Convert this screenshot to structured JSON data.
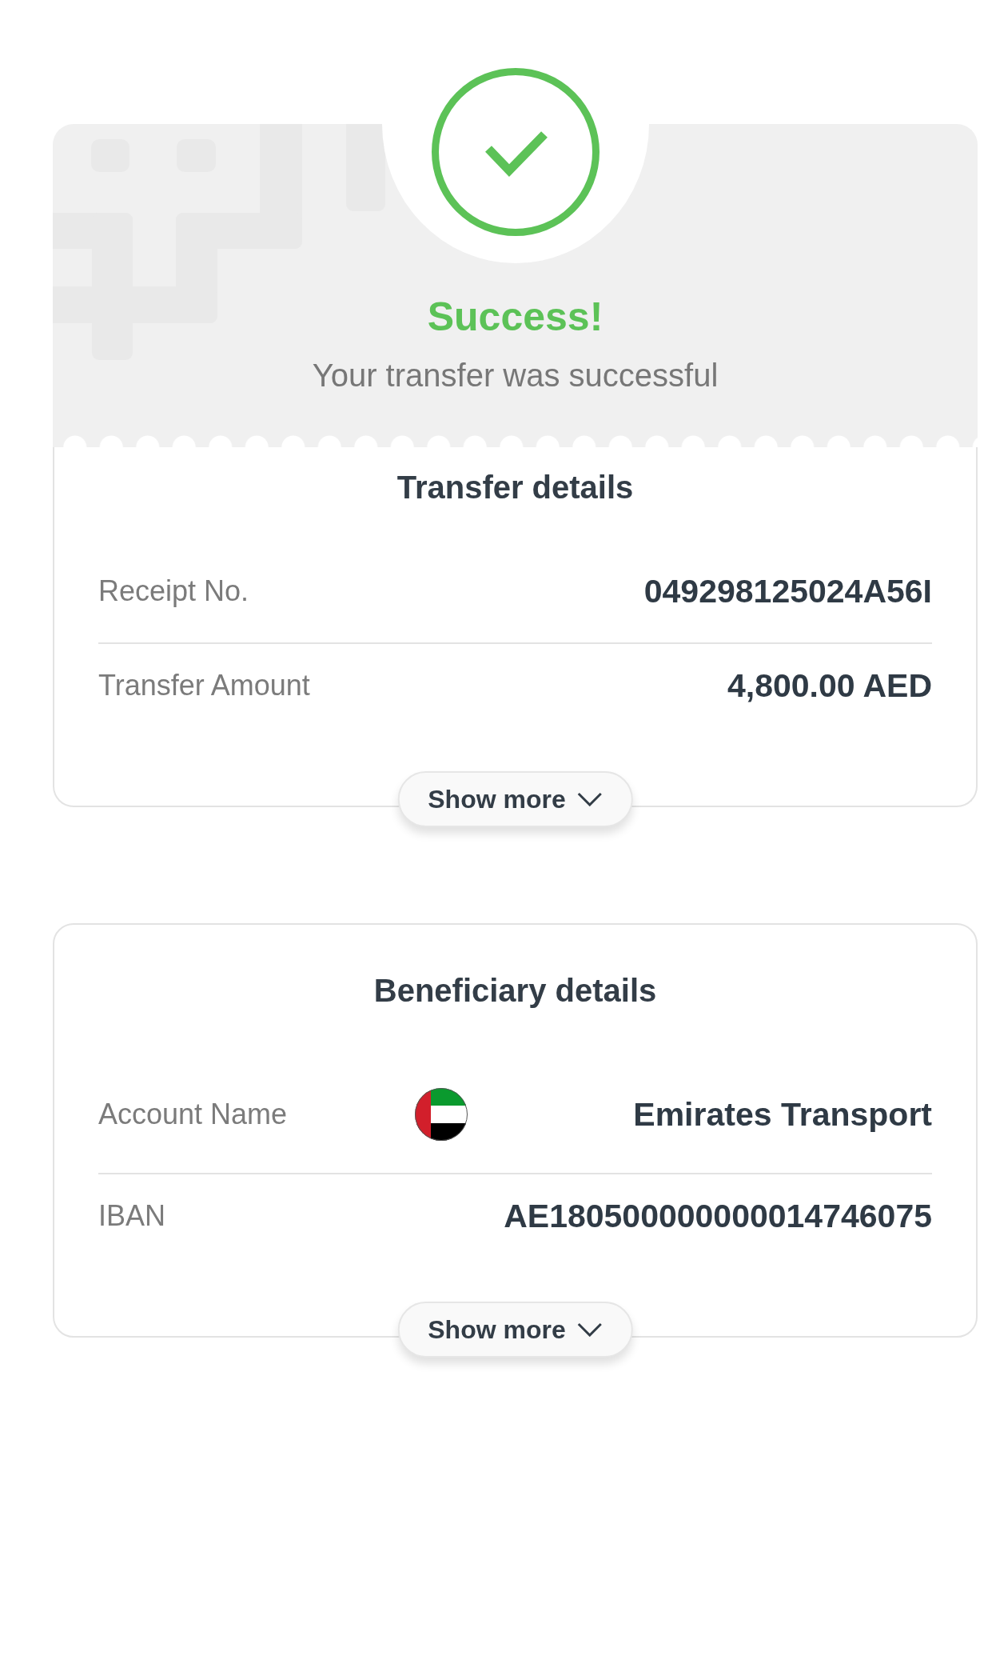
{
  "cards": [
    {
      "status": {
        "kind": "success",
        "title": "Success!",
        "message": "Your transfer was successful"
      },
      "title": "Transfer details",
      "rows": [
        {
          "kind": "plain",
          "label": "Receipt No.",
          "value": "049298125024A56I"
        },
        {
          "kind": "plain",
          "label": "Transfer Amount",
          "value": "4,800.00 AED"
        }
      ],
      "show_more": "Show more"
    },
    {
      "title": "Beneficiary details",
      "rows": [
        {
          "kind": "flagged",
          "label": "Account Name",
          "value": "Emirates Transport"
        },
        {
          "kind": "plain",
          "label": "IBAN",
          "value": "AE180500000000014746075"
        }
      ],
      "show_more": "Show more"
    }
  ]
}
